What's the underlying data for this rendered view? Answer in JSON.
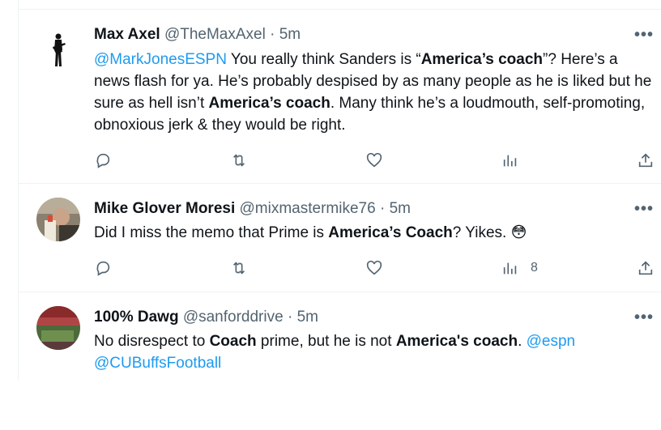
{
  "tweets": [
    {
      "name": "Max Axel",
      "handle": "@TheMaxAxel",
      "dot": "·",
      "time": "5m",
      "body": [
        {
          "t": "@MarkJonesESPN",
          "k": "link"
        },
        {
          "t": " You really think Sanders is “"
        },
        {
          "t": "America’s coach",
          "k": "b"
        },
        {
          "t": "”? Here’s a news flash for ya. He’s probably despised by as many people as he is liked but he sure as hell isn’t "
        },
        {
          "t": "America’s coach",
          "k": "b"
        },
        {
          "t": ". Many think he’s a loudmouth, self-promoting, obnoxious jerk & they would be right."
        }
      ],
      "views": ""
    },
    {
      "name": "Mike Glover Moresi",
      "handle": "@mixmastermike76",
      "dot": "·",
      "time": "5m",
      "body": [
        {
          "t": "Did I miss the memo that Prime is "
        },
        {
          "t": "America’s Coach",
          "k": "b"
        },
        {
          "t": "? Yikes. "
        },
        {
          "t": "😳"
        }
      ],
      "views": "8"
    },
    {
      "name": "100% Dawg",
      "handle": "@sanforddrive",
      "dot": "·",
      "time": "5m",
      "body": [
        {
          "t": "No disrespect to "
        },
        {
          "t": "Coach",
          "k": "b"
        },
        {
          "t": " prime, but he is not "
        },
        {
          "t": "America's coach",
          "k": "b"
        },
        {
          "t": ". "
        },
        {
          "t": "@espn",
          "k": "link"
        },
        {
          "t": " "
        },
        {
          "t": "@CUBuffsFootball",
          "k": "link"
        }
      ],
      "views": ""
    }
  ],
  "more_label": "•••",
  "icons": [
    "reply-icon",
    "retweet-icon",
    "like-icon",
    "views-icon",
    "share-icon"
  ],
  "colors": {
    "link": "#1d9bf0",
    "secondary": "#536471",
    "border": "#eff3f4"
  }
}
